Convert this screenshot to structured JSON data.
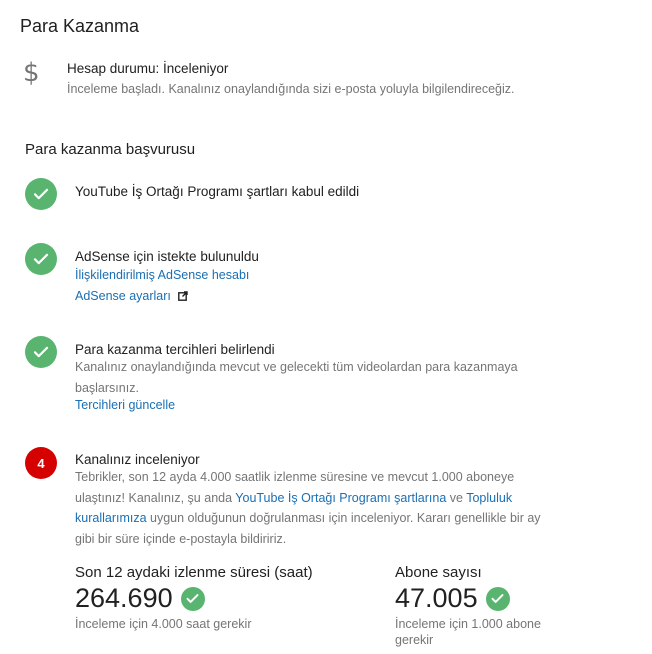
{
  "page": {
    "title": "Para Kazanma"
  },
  "status": {
    "icon": "dollar-icon",
    "icon_glyph": "$",
    "title": "Hesap durumu: İnceleniyor",
    "description": "İnceleme başladı. Kanalınız onaylandığında sizi e-posta yoluyla bilgilendireceğiz."
  },
  "application": {
    "title": "Para kazanma başvurusu",
    "steps": [
      {
        "icon": "check-icon",
        "title": "YouTube İş Ortağı Programı şartları kabul edildi"
      },
      {
        "icon": "check-icon",
        "title": "AdSense için istekte bulunuldu",
        "links": [
          "İlişkilendirilmiş AdSense hesabı",
          "AdSense ayarları"
        ]
      },
      {
        "icon": "check-icon",
        "title": "Para kazanma tercihleri belirlendi",
        "description_line1": "Kanalınız onaylandığında mevcut ve gelecekti tüm videolardan para kazanmaya",
        "description_line2": "başlarsınız.",
        "link": "Tercihleri güncelle"
      },
      {
        "icon": "number-badge",
        "badge": "4",
        "title": "Kanalınız inceleniyor",
        "text_1": "Tebrikler, son 12 ayda 4.000 saatlik izlenme süresine ve mevcut 1.000 aboneye ulaştınız! Kanalınız, şu anda ",
        "link_1": "YouTube İş Ortağı Programı şartlarına",
        "text_2": " ve ",
        "link_2": "Topluluk kurallarımıza",
        "text_3": " uygun olduğunun doğrulanması için inceleniyor. Kararı genellikle bir ay gibi bir süre içinde e-postayla bildiririz."
      }
    ]
  },
  "metrics": {
    "watch_hours": {
      "label": "Son 12 aydaki izlenme süresi (saat)",
      "value": "264.690",
      "note": "İnceleme için 4.000 saat gerekir"
    },
    "subscribers": {
      "label": "Abone sayısı",
      "value": "47.005",
      "note": "İnceleme için 1.000 abone gerekir"
    }
  },
  "colors": {
    "success": "#59b46f",
    "alert": "#d50000",
    "link": "#1a6fb3"
  }
}
